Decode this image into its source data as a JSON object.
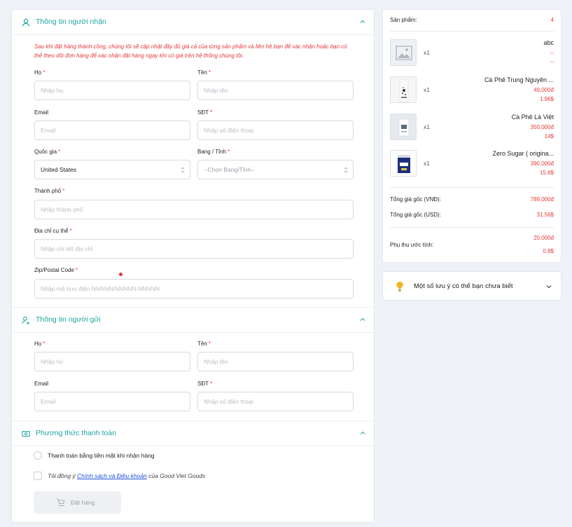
{
  "recipient": {
    "title": "Thông tin người nhận",
    "note": "Sau khi đặt hàng thành công, chúng tôi sẽ cập nhật đầy đủ giá cả của từng sản phẩm và liên hệ bạn để xác nhận hoặc bạn có thể theo dõi đơn hàng để xác nhận đặt hàng ngay khi có giá trên hệ thống chúng tôi.",
    "last_name_label": "Họ",
    "last_name_placeholder": "Nhập họ",
    "first_name_label": "Tên",
    "first_name_placeholder": "Nhập tên",
    "email_label": "Email",
    "email_placeholder": "Email",
    "phone_label": "SĐT",
    "phone_placeholder": "Nhập số điện thoại",
    "country_label": "Quốc gia",
    "country_value": "United States",
    "state_label": "Bang / Tỉnh",
    "state_value": "--Chọn Bang/Tỉnh--",
    "city_label": "Thành phố",
    "city_placeholder": "Nhập thành phố",
    "address_label": "Địa chỉ cụ thể",
    "address_placeholder": "Nhập chi tiết địa chỉ",
    "zip_label": "Zip/Postal Code",
    "zip_placeholder": "Nhập mã bưu điện NNNNN/NNNNN-NNNNN",
    "required_mark": "*"
  },
  "sender": {
    "title": "Thông tin người gửi",
    "last_name_label": "Họ",
    "last_name_placeholder": "Nhập họ",
    "first_name_label": "Tên",
    "first_name_placeholder": "Nhập tên",
    "email_label": "Email",
    "email_placeholder": "Email",
    "phone_label": "SĐT",
    "phone_placeholder": "Nhập số điện thoại"
  },
  "payment": {
    "title": "Phương thức thanh toán",
    "cod_label": "Thanh toán bằng tiền mặt khi nhận hàng",
    "agree_prefix": "Tôi đồng ý",
    "agree_link": "Chính sách và Điều khoản",
    "agree_suffix": "của Good Viet Goods",
    "order_button": "Đặt hàng"
  },
  "summary": {
    "products_label": "Sản phẩm:",
    "products_count": "4",
    "items": [
      {
        "qty": "x1",
        "name": "abc",
        "vnd": "--",
        "usd": "--"
      },
      {
        "qty": "x1",
        "name": "Cà Phê Trung Nguyên ...",
        "vnd": "49,000đ",
        "usd": "1.96$"
      },
      {
        "qty": "x1",
        "name": "Cà Phê Là Việt",
        "vnd": "350,000đ",
        "usd": "14$"
      },
      {
        "qty": "x1",
        "name": "Zero Sugar ( origina...",
        "vnd": "390,000đ",
        "usd": "15.6$"
      }
    ],
    "total_vnd_label": "Tổng giá gốc (VNĐ):",
    "total_vnd": "789,000đ",
    "total_usd_label": "Tổng giá gốc (USD):",
    "total_usd": "31.56$",
    "surcharge_label": "Phụ thu ước tính:",
    "surcharge_vnd": "20,000đ",
    "surcharge_usd": "0.8$"
  },
  "notes": {
    "title": "Một số lưu ý có thể bạn chưa biết",
    "icon": "lightbulb-icon"
  },
  "colors": {
    "accent": "#1aa5a0",
    "price": "#e53935",
    "background": "#eef2f7"
  }
}
